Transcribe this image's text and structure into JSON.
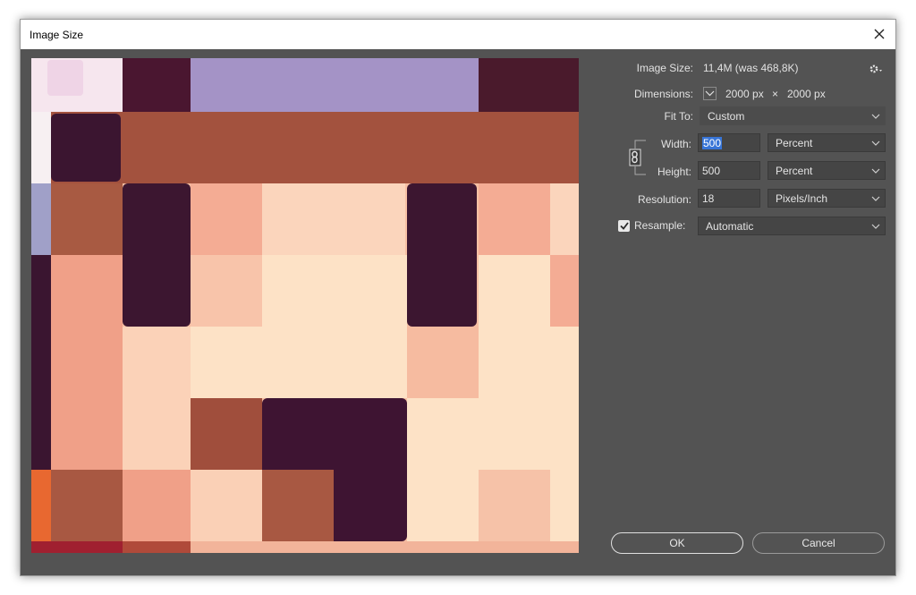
{
  "window": {
    "title": "Image Size"
  },
  "info": {
    "image_size_label": "Image Size:",
    "image_size_value": "11,4M (was 468,8K)",
    "dimensions_label": "Dimensions:",
    "dim_width": "2000 px",
    "dim_sep": "×",
    "dim_height": "2000 px"
  },
  "fit_to": {
    "label": "Fit To:",
    "value": "Custom"
  },
  "width": {
    "label": "Width:",
    "value": "500",
    "unit": "Percent"
  },
  "height": {
    "label": "Height:",
    "value": "500",
    "unit": "Percent"
  },
  "resolution": {
    "label": "Resolution:",
    "value": "18",
    "unit": "Pixels/Inch"
  },
  "resample": {
    "label": "Resample:",
    "checked": true,
    "method": "Automatic"
  },
  "buttons": {
    "ok": "OK",
    "cancel": "Cancel"
  },
  "colors": {
    "dialog_bg": "#535353",
    "field_bg": "#454545",
    "selection": "#3875d7",
    "preview_dark": "#3e1a2e",
    "preview_rust": "#9c4e3c",
    "preview_salmon": "#f0a088",
    "preview_cream": "#fde0c4",
    "preview_lavender": "#a490c4"
  }
}
